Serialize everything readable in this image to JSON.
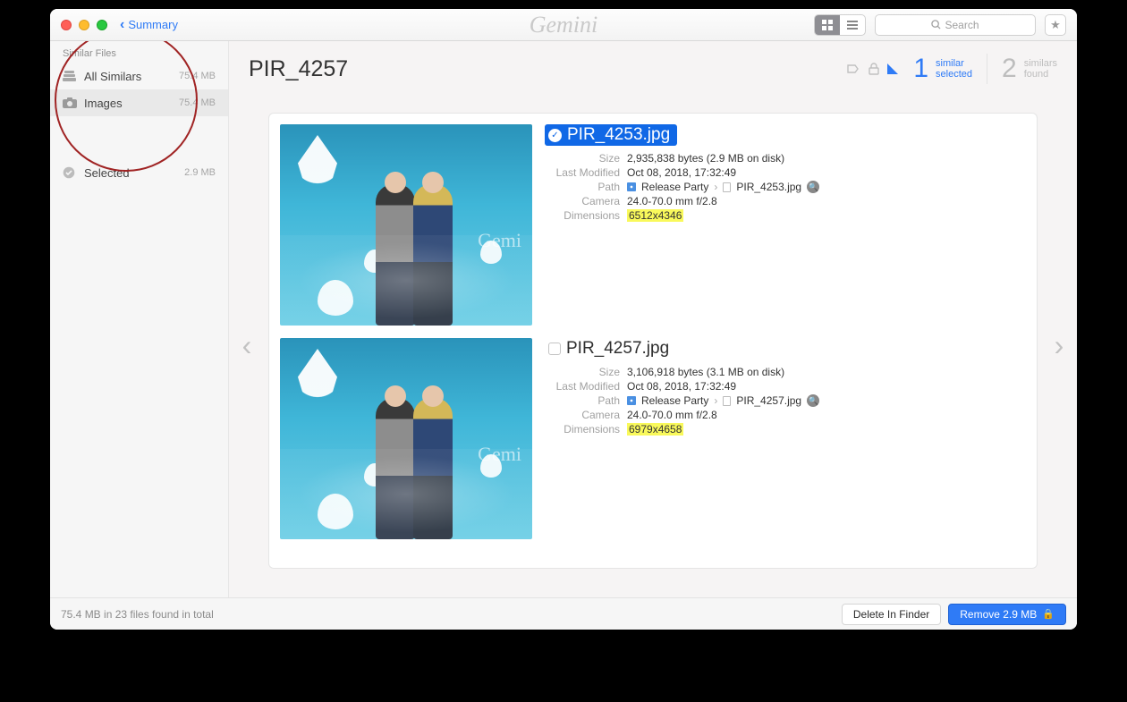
{
  "titlebar": {
    "back_label": "Summary",
    "app_name": "Gemini",
    "search_placeholder": "Search"
  },
  "sidebar": {
    "header": "Similar Files",
    "items": [
      {
        "icon": "stack",
        "label": "All Similars",
        "size": "75.4 MB",
        "active": false
      },
      {
        "icon": "camera",
        "label": "Images",
        "size": "75.4 MB",
        "active": true
      }
    ],
    "selected": {
      "label": "Selected",
      "size": "2.9 MB"
    }
  },
  "main": {
    "title": "PIR_4257",
    "stats": {
      "selected": {
        "num": "1",
        "line1": "similar",
        "line2": "selected"
      },
      "found": {
        "num": "2",
        "line1": "similars",
        "line2": "found"
      }
    },
    "files": [
      {
        "selected": true,
        "name": "PIR_4253.jpg",
        "size": "2,935,838 bytes (2.9 MB on disk)",
        "modified": "Oct 08, 2018, 17:32:49",
        "path_folder": "Release Party",
        "path_file": "PIR_4253.jpg",
        "camera": "24.0-70.0 mm f/2.8",
        "dimensions": "6512x4346",
        "dim_highlight": true
      },
      {
        "selected": false,
        "name": "PIR_4257.jpg",
        "size": "3,106,918 bytes (3.1 MB on disk)",
        "modified": "Oct 08, 2018, 17:32:49",
        "path_folder": "Release Party",
        "path_file": "PIR_4257.jpg",
        "camera": "24.0-70.0 mm f/2.8",
        "dimensions": "6979x4658",
        "dim_highlight": true
      }
    ]
  },
  "labels": {
    "size": "Size",
    "modified": "Last Modified",
    "path": "Path",
    "camera": "Camera",
    "dimensions": "Dimensions"
  },
  "footer": {
    "status": "75.4 MB in 23 files found in total",
    "delete_label": "Delete In Finder",
    "remove_label": "Remove 2.9 MB"
  }
}
